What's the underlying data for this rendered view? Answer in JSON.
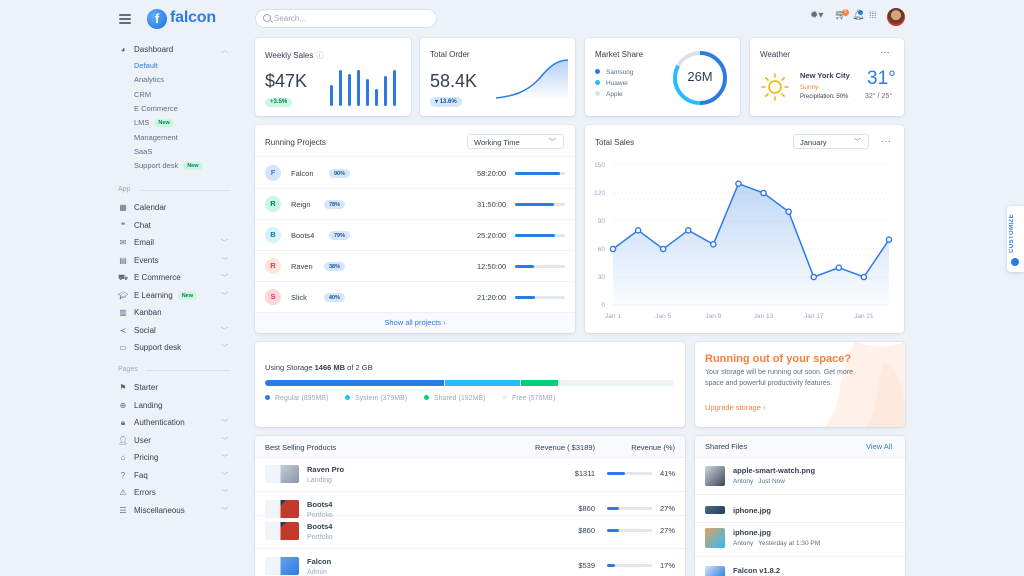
{
  "brand": {
    "name": "falcon",
    "mark": "f"
  },
  "search": {
    "placeholder": "Search..."
  },
  "header": {
    "cart_count": "5"
  },
  "sidebar": {
    "dashboard": {
      "label": "Dashboard",
      "items": [
        "Default",
        "Analytics",
        "CRM",
        "E Commerce",
        "LMS",
        "Management",
        "SaaS",
        "Support desk"
      ],
      "new_badge": "New"
    },
    "app_section": "App",
    "app_items": [
      "Calendar",
      "Chat",
      "Email",
      "Events",
      "E Commerce",
      "E Learning",
      "Kanban",
      "Social",
      "Support desk"
    ],
    "pages_section": "Pages",
    "pages_items": [
      "Starter",
      "Landing",
      "Authentication",
      "User",
      "Pricing",
      "Faq",
      "Errors",
      "Miscellaneous"
    ]
  },
  "weekly_sales": {
    "title": "Weekly Sales",
    "value": "$47K",
    "change": "3.5%",
    "bars": [
      0.55,
      0.95,
      0.85,
      0.95,
      0.7,
      0.45,
      0.8,
      0.95
    ]
  },
  "total_order": {
    "title": "Total Order",
    "value": "58.4K",
    "change": "13.6%"
  },
  "market_share": {
    "title": "Market Share",
    "total": "26M",
    "legend": [
      {
        "name": "Samsung",
        "color": "#2c7be5",
        "share": 0.5
      },
      {
        "name": "Huawei",
        "color": "#27bcfd",
        "share": 0.33
      },
      {
        "name": "Apple",
        "color": "#d8e2ef",
        "share": 0.17
      }
    ]
  },
  "weather": {
    "title": "Weather",
    "city": "New York City",
    "condition": "Sunny",
    "precip": "Precipitation: 50%",
    "temp": "31°",
    "range": "32° / 25°"
  },
  "running_projects": {
    "title": "Running Projects",
    "filter": "Working Time",
    "projects": [
      {
        "initial": "F",
        "name": "Falcon",
        "percent": "90%",
        "time": "58:20:00",
        "fill": 0.9,
        "bg": "#d5e5fa",
        "fg": "#2c7be5"
      },
      {
        "initial": "R",
        "name": "Reign",
        "percent": "78%",
        "time": "31:50:00",
        "fill": 0.78,
        "bg": "#ccf6e4",
        "fg": "#00864e"
      },
      {
        "initial": "B",
        "name": "Boots4",
        "percent": "79%",
        "time": "25:20:00",
        "fill": 0.79,
        "bg": "#d4f2ff",
        "fg": "#1978a2"
      },
      {
        "initial": "R",
        "name": "Raven",
        "percent": "38%",
        "time": "12:50:00",
        "fill": 0.38,
        "bg": "#fde6d8",
        "fg": "#e63757"
      },
      {
        "initial": "S",
        "name": "Slick",
        "percent": "40%",
        "time": "21:20:00",
        "fill": 0.4,
        "bg": "#fad7dd",
        "fg": "#e63757"
      }
    ],
    "footer_link": "Show all projects ›"
  },
  "total_sales": {
    "title": "Total Sales",
    "filter": "January"
  },
  "chart_data": {
    "type": "line",
    "title": "Total Sales",
    "x": [
      "Jan 1",
      "Jan 3",
      "Jan 5",
      "Jan 7",
      "Jan 9",
      "Jan 11",
      "Jan 13",
      "Jan 15",
      "Jan 17",
      "Jan 19",
      "Jan 21",
      "Jan 23"
    ],
    "x_tick_labels": [
      "Jan 1",
      "Jan 5",
      "Jan 9",
      "Jan 13",
      "Jan 17",
      "Jan 21"
    ],
    "series": [
      {
        "values": [
          60,
          80,
          60,
          80,
          65,
          130,
          120,
          100,
          30,
          40,
          30,
          70
        ]
      }
    ],
    "yticks": [
      0,
      30,
      60,
      90,
      120,
      150
    ],
    "ylim": [
      0,
      150
    ],
    "grid": true,
    "color": "#2c7be5"
  },
  "storage": {
    "label": "Using Storage",
    "used": "1466 MB",
    "total": "of 2 GB",
    "segments": [
      {
        "name": "Regular",
        "size": "(895MB)",
        "color": "#2c7be5",
        "share": 0.439
      },
      {
        "name": "System",
        "size": "(379MB)",
        "color": "#27bcfd",
        "share": 0.186
      },
      {
        "name": "Shared",
        "size": "(192MB)",
        "color": "#00d27a",
        "share": 0.094
      },
      {
        "name": "Free",
        "size": "(576MB)",
        "color": "#edf2f9",
        "share": 0.281
      }
    ]
  },
  "promo": {
    "title": "Running out of your space?",
    "text_line1": "Your storage will be running out soon. Get more",
    "text_line2": "space and powerful productivity features.",
    "link": "Upgrade storage ›"
  },
  "best_selling": {
    "title": "Best Selling Products",
    "col_revenue": "Revenue ( $3189)",
    "col_percent": "Revenue (%)",
    "rows": [
      {
        "name": "Raven Pro",
        "category": "Landing",
        "revenue": "$1311",
        "percent": "41%",
        "fill": 0.41
      },
      {
        "name": "Boots4",
        "category": "Portfolio",
        "revenue": "$860",
        "percent": "27%",
        "fill": 0.27
      },
      {
        "name": "Boots4",
        "category": "Portfolio",
        "revenue": "$860",
        "percent": "27%",
        "fill": 0.27
      },
      {
        "name": "Falcon",
        "category": "Admin",
        "revenue": "$539",
        "percent": "17%",
        "fill": 0.17
      }
    ]
  },
  "shared_files": {
    "title": "Shared Files",
    "view_all": "View All",
    "files": [
      {
        "name": "apple-smart-watch.png",
        "owner": "Antony",
        "time": "Just Now"
      },
      {
        "name": "iphone.jpg",
        "owner": "",
        "time": ""
      },
      {
        "name": "iphone.jpg",
        "owner": "Antony",
        "time": "Yesterday at 1:30 PM"
      },
      {
        "name": "Falcon v1.8.2",
        "owner": "",
        "time": ""
      }
    ]
  },
  "customize": {
    "label": "CUSTOMIZE"
  }
}
